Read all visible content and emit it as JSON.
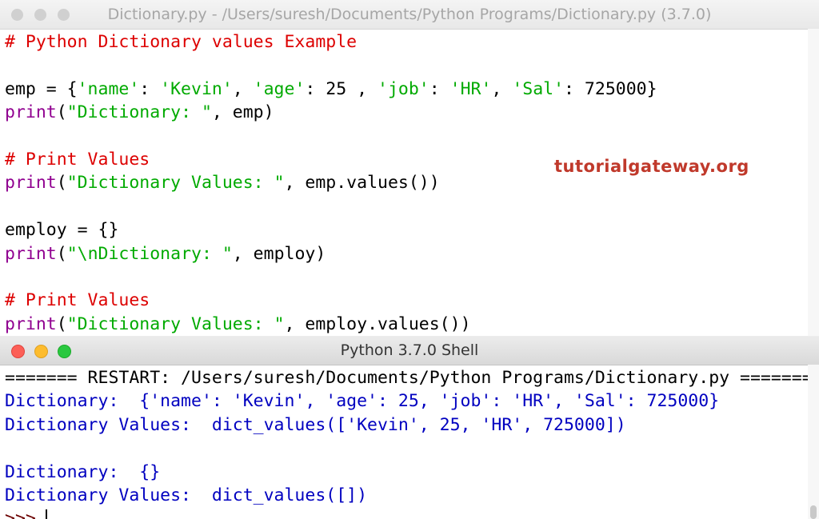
{
  "editor": {
    "title": "Dictionary.py - /Users/suresh/Documents/Python Programs/Dictionary.py (3.7.0)",
    "lines": [
      [
        {
          "t": "# Python Dictionary values Example",
          "c": "cm"
        }
      ],
      [],
      [
        {
          "t": "emp = {",
          "c": "df"
        },
        {
          "t": "'name'",
          "c": "st"
        },
        {
          "t": ": ",
          "c": "df"
        },
        {
          "t": "'Kevin'",
          "c": "st"
        },
        {
          "t": ", ",
          "c": "df"
        },
        {
          "t": "'age'",
          "c": "st"
        },
        {
          "t": ": 25 , ",
          "c": "df"
        },
        {
          "t": "'job'",
          "c": "st"
        },
        {
          "t": ": ",
          "c": "df"
        },
        {
          "t": "'HR'",
          "c": "st"
        },
        {
          "t": ", ",
          "c": "df"
        },
        {
          "t": "'Sal'",
          "c": "st"
        },
        {
          "t": ": 725000}",
          "c": "df"
        }
      ],
      [
        {
          "t": "print",
          "c": "kw"
        },
        {
          "t": "(",
          "c": "df"
        },
        {
          "t": "\"Dictionary: \"",
          "c": "st"
        },
        {
          "t": ", emp)",
          "c": "df"
        }
      ],
      [],
      [
        {
          "t": "# Print Values",
          "c": "cm"
        }
      ],
      [
        {
          "t": "print",
          "c": "kw"
        },
        {
          "t": "(",
          "c": "df"
        },
        {
          "t": "\"Dictionary Values: \"",
          "c": "st"
        },
        {
          "t": ", emp.values())",
          "c": "df"
        }
      ],
      [],
      [
        {
          "t": "employ = {}",
          "c": "df"
        }
      ],
      [
        {
          "t": "print",
          "c": "kw"
        },
        {
          "t": "(",
          "c": "df"
        },
        {
          "t": "\"\\nDictionary: \"",
          "c": "st"
        },
        {
          "t": ", employ)",
          "c": "df"
        }
      ],
      [],
      [
        {
          "t": "# Print Values",
          "c": "cm"
        }
      ],
      [
        {
          "t": "print",
          "c": "kw"
        },
        {
          "t": "(",
          "c": "df"
        },
        {
          "t": "\"Dictionary Values: \"",
          "c": "st"
        },
        {
          "t": ", employ.values())",
          "c": "df"
        }
      ]
    ]
  },
  "watermark": "tutorialgateway.org",
  "shell": {
    "title": "Python 3.7.0 Shell",
    "lines": [
      [
        {
          "t": "======= RESTART: /Users/suresh/Documents/Python Programs/Dictionary.py =======",
          "c": "rs"
        }
      ],
      [
        {
          "t": "Dictionary:  {'name': 'Kevin', 'age': 25, 'job': 'HR', 'Sal': 725000}",
          "c": "out"
        }
      ],
      [
        {
          "t": "Dictionary Values:  dict_values(['Kevin', 25, 'HR', 725000])",
          "c": "out"
        }
      ],
      [],
      [
        {
          "t": "Dictionary:  {}",
          "c": "out"
        }
      ],
      [
        {
          "t": "Dictionary Values:  dict_values([])",
          "c": "out"
        }
      ]
    ],
    "prompt": ">>>"
  },
  "colors": {
    "close": "#fc5f57",
    "minimize": "#fdbc2e",
    "maximize": "#2ac840",
    "inactive_dot": "#d0d0d0",
    "comment": "#dd0000",
    "keyword": "#900090",
    "string": "#00aa00",
    "output": "#0000c0"
  }
}
